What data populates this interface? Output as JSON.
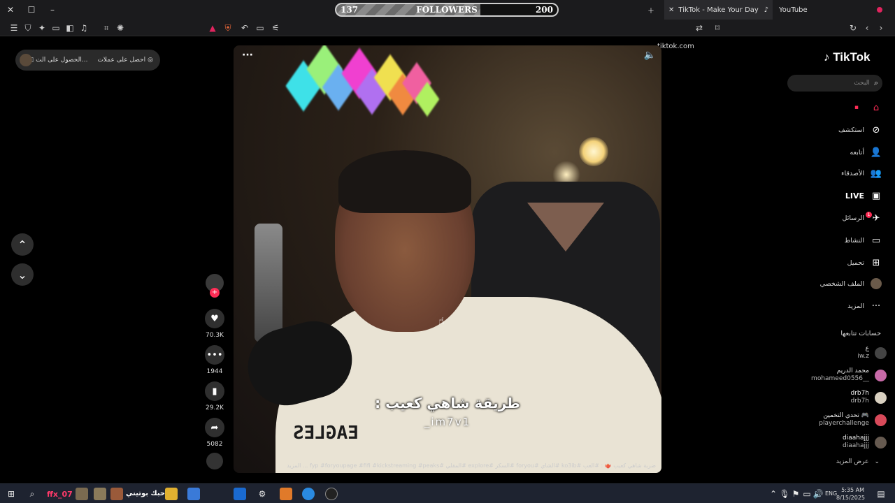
{
  "browser": {
    "followers_widget": {
      "left_value": "137",
      "label": "FOLLOWERS",
      "right_value": "200"
    },
    "tabs": [
      {
        "label": "TikTok - Make Your Day"
      },
      {
        "label": "YouTube"
      }
    ],
    "address": "tiktok.com"
  },
  "left_panel": {
    "promo_text_1": "احصل على عملات",
    "promo_text_2": "الحصول على الت..."
  },
  "video": {
    "caption_main": "طريقة شاهي كعيب :",
    "caption_user": "_im7v1",
    "shirt_print": "EAGLES",
    "hashtags": "ضربة شاهي كعيب 🫖 : #العب #ko3ib #الشاي #foryou #السكر #explore #المقلي #fyp #foryoupage #fifi #kickstreaming #peaks ... المزيد",
    "more_label": "المزيد"
  },
  "actions": {
    "likes": "70.3K",
    "comments": "1944",
    "saves": "29.2K",
    "shares": "5082"
  },
  "sidebar": {
    "logo": "TikTok",
    "search_placeholder": "البحث",
    "nav": [
      {
        "label": "",
        "icon": "home-icon"
      },
      {
        "label": "استكشف",
        "icon": "compass-icon"
      },
      {
        "label": "أتابعه",
        "icon": "user-follow-icon"
      },
      {
        "label": "الأصدقاء",
        "icon": "friends-icon"
      },
      {
        "label": "LIVE",
        "icon": "live-icon"
      },
      {
        "label": "الرسائل",
        "icon": "messages-icon"
      },
      {
        "label": "النشاط",
        "icon": "activity-icon"
      },
      {
        "label": "تحميل",
        "icon": "upload-icon"
      },
      {
        "label": "الملف الشخصي",
        "icon": "profile-avatar"
      },
      {
        "label": "المزيد",
        "icon": "more-icon"
      }
    ],
    "messages_badge": "1",
    "following_title": "حسابات تتابعها",
    "accounts": [
      {
        "name": "ع",
        "handle": "iw.z"
      },
      {
        "name": "محمد الدريم",
        "handle": "mohameed0556__"
      },
      {
        "name": "drb7h",
        "handle": "drb7h"
      },
      {
        "name": "تحدي التخمين 🎮",
        "handle": "playerchallenge"
      },
      {
        "name": "diaahajjj",
        "handle": "diaahajjj"
      }
    ],
    "see_more": "عرض المزيد"
  },
  "taskbar": {
    "app_label_1": "ffx_07",
    "app_label_2": "احبك بوتيني",
    "lang": "ENG",
    "time": "5:35 AM",
    "date": "8/15/2025"
  }
}
